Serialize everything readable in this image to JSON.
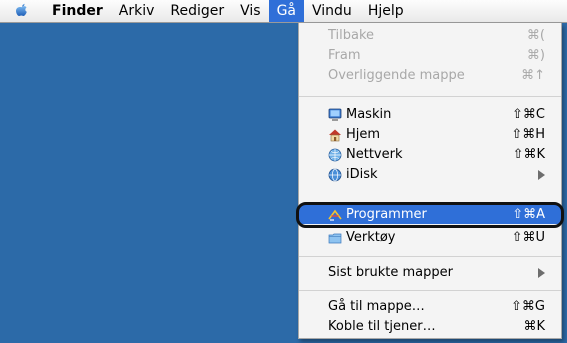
{
  "menubar": {
    "apple_icon": "apple-icon",
    "items": [
      {
        "label": "Finder",
        "bold": true
      },
      {
        "label": "Arkiv"
      },
      {
        "label": "Rediger"
      },
      {
        "label": "Vis"
      },
      {
        "label": "Gå",
        "active": true
      },
      {
        "label": "Vindu"
      },
      {
        "label": "Hjelp"
      }
    ]
  },
  "menu": {
    "items": [
      {
        "label": "Tilbake",
        "shortcut": "⌘(",
        "disabled": true
      },
      {
        "label": "Fram",
        "shortcut": "⌘)",
        "disabled": true
      },
      {
        "label": "Overliggende mappe",
        "shortcut": "⌘↑",
        "disabled": true
      },
      {
        "label": "Maskin",
        "shortcut": "⇧⌘C",
        "icon": "computer-icon"
      },
      {
        "label": "Hjem",
        "shortcut": "⇧⌘H",
        "icon": "home-icon"
      },
      {
        "label": "Nettverk",
        "shortcut": "⇧⌘K",
        "icon": "network-globe-icon"
      },
      {
        "label": "iDisk",
        "submenu": true,
        "icon": "idisk-globe-icon"
      },
      {
        "label": "Programmer",
        "shortcut": "⇧⌘A",
        "icon": "applications-icon",
        "selected": true
      },
      {
        "label": "Verktøy",
        "shortcut": "⇧⌘U",
        "icon": "utilities-folder-icon"
      },
      {
        "label": "Sist brukte mapper",
        "submenu": true
      },
      {
        "label": "Gå til mappe…",
        "shortcut": "⇧⌘G"
      },
      {
        "label": "Koble til tjener…",
        "shortcut": "⌘K"
      }
    ]
  },
  "colors": {
    "desktop": "#2c6aa8",
    "selection": "#2f6fd8",
    "disabled_text": "#a8a8a8"
  }
}
